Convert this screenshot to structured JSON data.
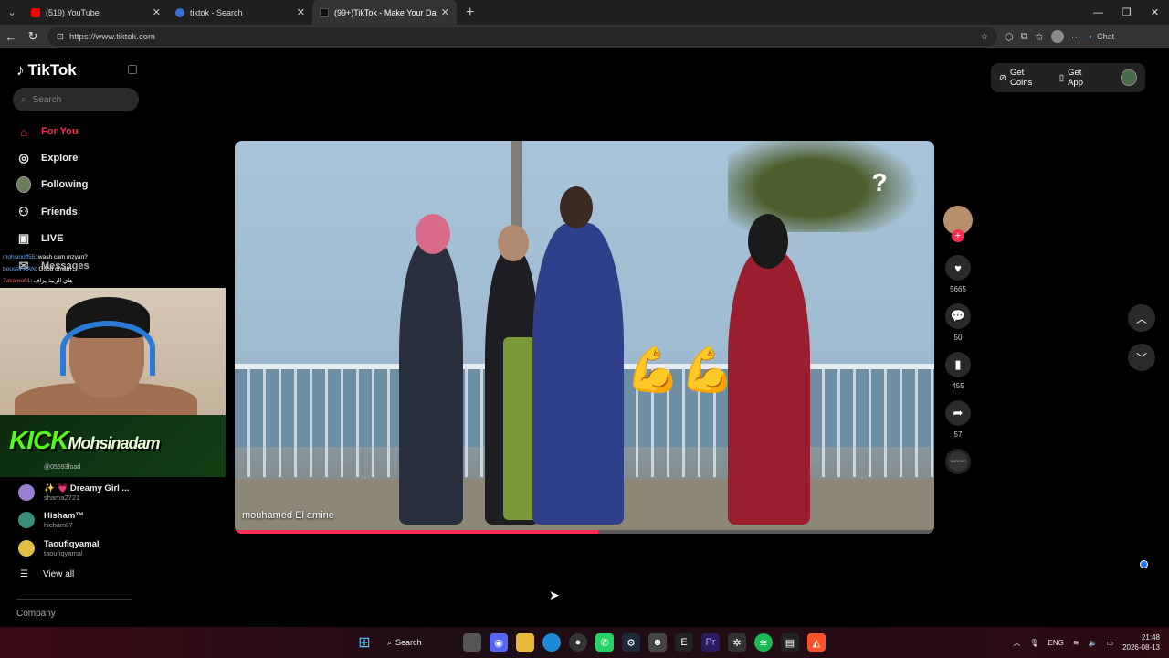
{
  "browser": {
    "tabs": [
      {
        "title": "(519) YouTube",
        "favicon_color": "#ff0000",
        "active": false
      },
      {
        "title": "tiktok - Search",
        "favicon_color": "#3b6fd6",
        "active": false
      },
      {
        "title": "(99+)TikTok - Make Your Day",
        "favicon_color": "#111111",
        "active": true
      }
    ],
    "new_tab": "+",
    "url": "https://www.tiktok.com",
    "chat_label": "Chat"
  },
  "sidebar": {
    "logo": "TikTok",
    "search_placeholder": "Search",
    "nav": [
      {
        "label": "For You",
        "icon": "home-icon",
        "glyph": "⌂",
        "active": true
      },
      {
        "label": "Explore",
        "icon": "compass-icon",
        "glyph": "◎",
        "active": false
      },
      {
        "label": "Following",
        "icon": "following-avatar-icon",
        "glyph": "●",
        "active": false
      },
      {
        "label": "Friends",
        "icon": "friends-icon",
        "glyph": "👥",
        "active": false
      },
      {
        "label": "LIVE",
        "icon": "live-icon",
        "glyph": "▣",
        "active": false
      },
      {
        "label": "Messages",
        "icon": "messages-icon",
        "glyph": "✉",
        "active": false
      }
    ],
    "chat_overlay": [
      {
        "user": "mohsinoff55",
        "text": ": wash cam mzyan?"
      },
      {
        "user": "boussiFAAN",
        "text": ": Good dmam"
      },
      {
        "user": "7akamo01",
        "text": ": هاي الربية يزاف"
      }
    ],
    "stream_banner": {
      "brand": "KICK",
      "channel": "Mohsinadam",
      "sub": "@05593foad"
    },
    "following_accounts": [
      {
        "name": "✨ 💗 Dreamy Girl ...",
        "handle": "shama2721",
        "color": "#9a7fd1"
      },
      {
        "name": "Hisham™",
        "handle": "hichamll7",
        "color": "#3a8f7a"
      },
      {
        "name": "Taoufiqyamal",
        "handle": "taoufiqyamal",
        "color": "#e0c040"
      }
    ],
    "view_all": "View all",
    "company": "Company"
  },
  "header": {
    "get_coins": "Get Coins",
    "get_app": "Get App"
  },
  "video": {
    "author": "mouhamed El amine",
    "progress": 0.52,
    "overlay_badge": "?",
    "emoji": "💪💪"
  },
  "actions": {
    "likes": "5665",
    "comments": "50",
    "saves": "455",
    "shares": "57",
    "music_label": "PATIENT"
  },
  "taskbar": {
    "search_label": "Search",
    "lang": "ENG",
    "time": "21:48",
    "date": "2026-08-13"
  }
}
